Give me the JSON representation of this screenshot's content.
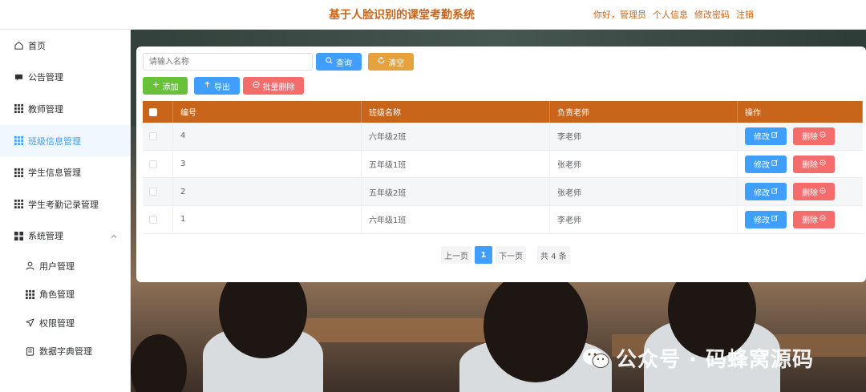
{
  "header": {
    "title": "基于人脸识别的课堂考勤系统",
    "greeting": "你好，管理员",
    "profile": "个人信息",
    "change_password": "修改密码",
    "logout": "注销"
  },
  "sidebar": {
    "items": [
      {
        "label": "首页",
        "icon": "home-icon"
      },
      {
        "label": "公告管理",
        "icon": "message-icon"
      },
      {
        "label": "教师管理",
        "icon": "grid-icon"
      },
      {
        "label": "班级信息管理",
        "icon": "grid-icon",
        "active": true
      },
      {
        "label": "学生信息管理",
        "icon": "grid-icon"
      },
      {
        "label": "学生考勤记录管理",
        "icon": "grid-icon"
      },
      {
        "label": "系统管理",
        "icon": "menu-icon",
        "expanded": true
      }
    ],
    "sub_items": [
      {
        "label": "用户管理",
        "icon": "user-icon"
      },
      {
        "label": "角色管理",
        "icon": "grid-icon"
      },
      {
        "label": "权限管理",
        "icon": "send-icon"
      },
      {
        "label": "数据字典管理",
        "icon": "document-icon"
      }
    ]
  },
  "toolbar": {
    "search_placeholder": "请输入名称",
    "query_label": "查询",
    "reset_label": "清空",
    "add_label": "添加",
    "export_label": "导出",
    "batch_delete_label": "批量删除"
  },
  "table": {
    "headers": [
      "编号",
      "班级名称",
      "负责老师",
      "操作"
    ],
    "rows": [
      {
        "id": "4",
        "name": "六年级2班",
        "teacher": "李老师"
      },
      {
        "id": "3",
        "name": "五年级1班",
        "teacher": "张老师"
      },
      {
        "id": "2",
        "name": "五年级2班",
        "teacher": "张老师"
      },
      {
        "id": "1",
        "name": "六年级1班",
        "teacher": "李老师"
      }
    ],
    "edit_label": "修改",
    "delete_label": "删除"
  },
  "pagination": {
    "prev_label": "上一页",
    "current_page": "1",
    "next_label": "下一页",
    "total_label": "共 4 条"
  },
  "watermark": {
    "text": "公众号 · 码蜂窝源码"
  },
  "colors": {
    "brand": "#c8651b",
    "primary": "#409eff",
    "success": "#67c23a",
    "warning": "#e6a23c",
    "danger": "#f56c6c"
  }
}
